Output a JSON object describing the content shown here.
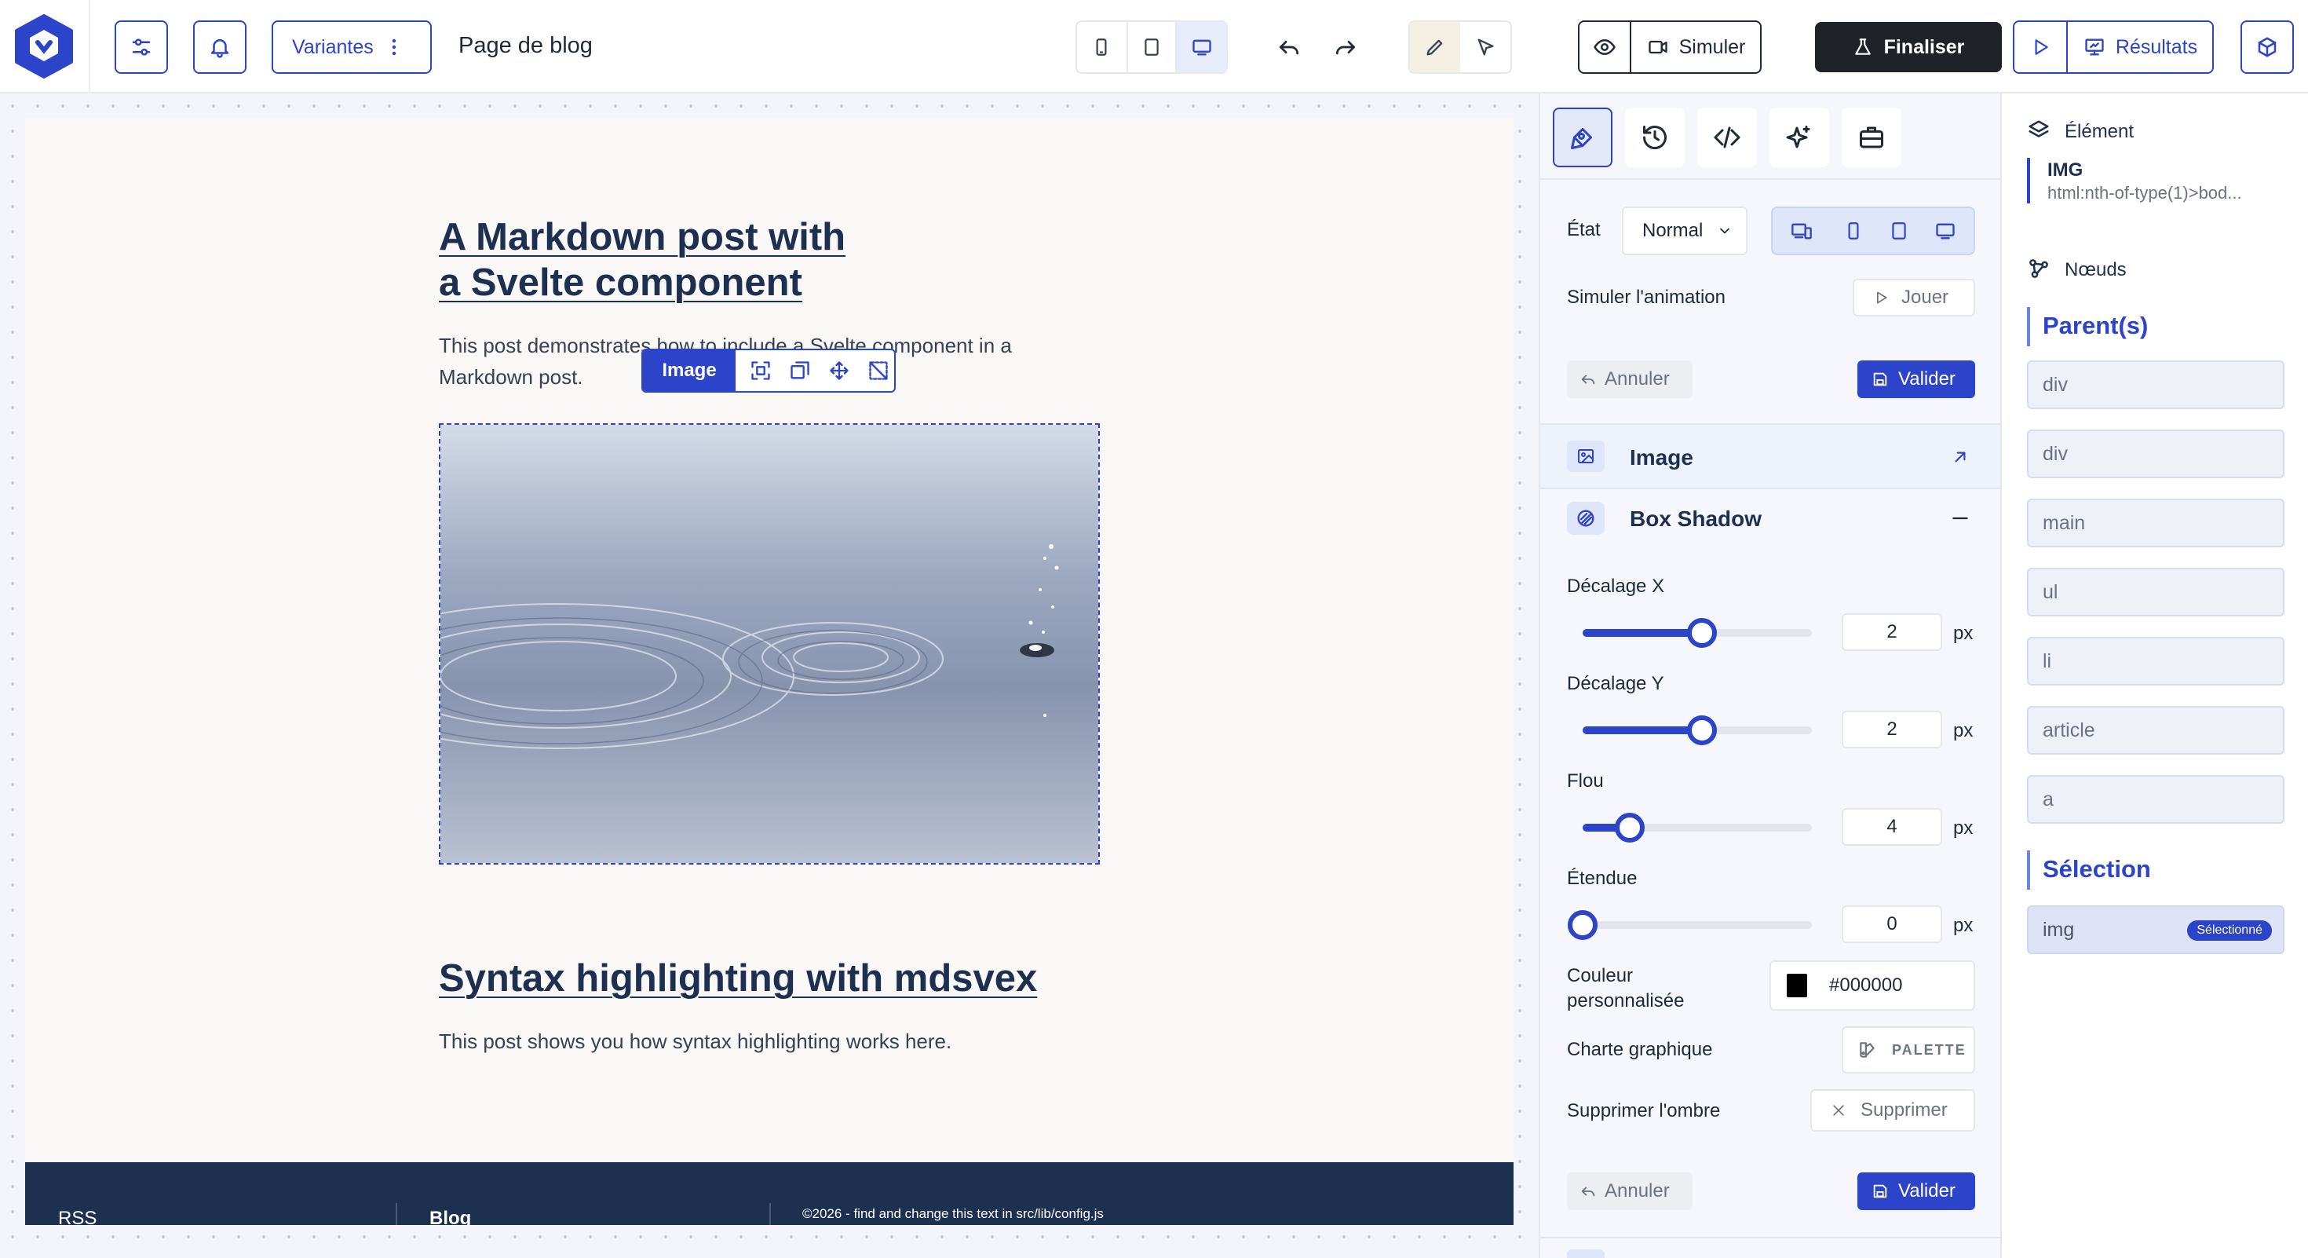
{
  "topbar": {
    "variants_label": "Variantes",
    "page_title": "Page de blog",
    "simulate_label": "Simuler",
    "finalize_label": "Finaliser",
    "results_label": "Résultats"
  },
  "content": {
    "post1_title_line1": "A Markdown post with",
    "post1_title_line2": "a Svelte component",
    "post1_desc_line1": "This post demonstrates how to include a Svelte component in a",
    "post1_desc_line2": "Markdown post.",
    "image_toolbar_label": "Image",
    "post2_title": "Syntax highlighting with mdsvex",
    "post2_desc": "This post shows you how syntax highlighting works here."
  },
  "footer": {
    "rss": "RSS",
    "blog": "Blog",
    "copyright": "©2026 - find and change this text in src/lib/config.js"
  },
  "panel": {
    "state_label": "État",
    "state_value": "Normal",
    "simulate_animation_label": "Simuler l'animation",
    "play_label": "Jouer",
    "cancel_label": "Annuler",
    "validate_label": "Valider",
    "image_section": "Image",
    "box_shadow_section": "Box Shadow",
    "unit": "px",
    "sliders": [
      {
        "label": "Décalage X",
        "value": "2"
      },
      {
        "label": "Décalage Y",
        "value": "2"
      },
      {
        "label": "Flou",
        "value": "4"
      },
      {
        "label": "Étendue",
        "value": "0"
      }
    ],
    "custom_color_label_line1": "Couleur",
    "custom_color_label_line2": "personnalisée",
    "color_value": "#000000",
    "brand_label": "Charte graphique",
    "palette_label": "PALETTE",
    "remove_shadow_label": "Supprimer l'ombre",
    "remove_label": "Supprimer"
  },
  "inspector": {
    "element_label": "Élément",
    "element_tag": "IMG",
    "element_selector": "html:nth-of-type(1)>bod...",
    "nodes_label": "Nœuds",
    "parents_label": "Parent(s)",
    "parents": [
      "div",
      "div",
      "main",
      "ul",
      "li",
      "article",
      "a"
    ],
    "selection_label": "Sélection",
    "selected_node": "img",
    "selected_badge": "Sélectionné"
  },
  "colors": {
    "accent": "#2b44c9",
    "heading": "#1e3050",
    "footer_bg": "#1e3050",
    "swatch": "#000000"
  }
}
